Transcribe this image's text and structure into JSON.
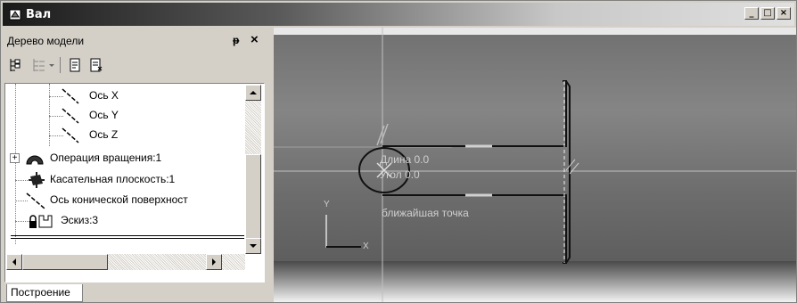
{
  "window": {
    "title": "Вал",
    "minimize": "_",
    "maximize": "□",
    "close": "×"
  },
  "panel": {
    "title": "Дерево модели",
    "pin": "ᵽ",
    "close": "×",
    "toolbar": [
      "tree-view-icon",
      "tree-options-icon",
      "dropdown-arrow-icon",
      "document-icon",
      "properties-icon"
    ]
  },
  "tree": {
    "items": [
      {
        "label": "Ось X",
        "icon": "axis-icon"
      },
      {
        "label": "Ось Y",
        "icon": "axis-icon"
      },
      {
        "label": "Ось Z",
        "icon": "axis-icon"
      },
      {
        "label": "Операция вращения:1",
        "icon": "revolve-icon",
        "expand": "+"
      },
      {
        "label": "Касательная плоскость:1",
        "icon": "plane-icon"
      },
      {
        "label": "Ось конической поверхност",
        "icon": "axis-icon"
      },
      {
        "label": "Эскиз:3",
        "icon": "sketch-icon"
      }
    ]
  },
  "tabs": {
    "active": "Построение"
  },
  "viewport": {
    "length_label": "Длина 0.0",
    "angle_label": "Угол 0.0",
    "snap_hint": "ближайшая точка",
    "axis_y": "Y",
    "axis_x": "X"
  }
}
